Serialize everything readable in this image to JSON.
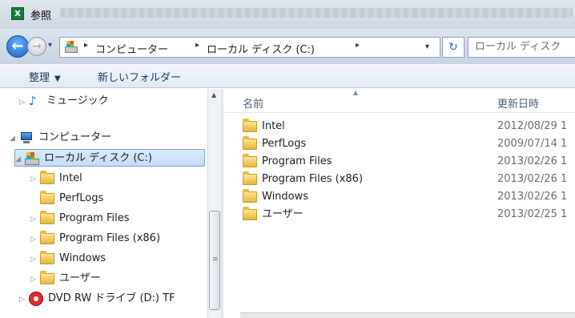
{
  "window": {
    "title": "参照",
    "app_icon_text": "X"
  },
  "navigation": {
    "back_label": "←",
    "forward_label": "→",
    "history_label": "▾",
    "breadcrumbs": [
      "コンピューター",
      "ローカル ディスク (C:)"
    ],
    "separator": "▸",
    "dropdown": "▾",
    "refresh_label": "↻",
    "search_placeholder": "ローカル ディスク"
  },
  "toolbar": {
    "organize_label": "整理",
    "organize_arrow": "▼",
    "new_folder_label": "新しいフォルダー"
  },
  "tree": {
    "music": "ミュージック",
    "computer": "コンピューター",
    "local_disk": "ローカル ディスク (C:)",
    "folders": [
      "Intel",
      "PerfLogs",
      "Program Files",
      "Program Files (x86)",
      "Windows",
      "ユーザー"
    ],
    "dvd": "DVD RW ドライブ (D:) TF"
  },
  "list": {
    "columns": {
      "name": "名前",
      "modified": "更新日時"
    },
    "rows": [
      {
        "name": "Intel",
        "date": "2012/08/29 1"
      },
      {
        "name": "PerfLogs",
        "date": "2009/07/14 1"
      },
      {
        "name": "Program Files",
        "date": "2013/02/26 1"
      },
      {
        "name": "Program Files (x86)",
        "date": "2013/02/26 1"
      },
      {
        "name": "Windows",
        "date": "2013/02/26 1"
      },
      {
        "name": "ユーザー",
        "date": "2013/02/25 1"
      }
    ]
  },
  "colors": {
    "selection": "#c1dcfc",
    "toolbar": "#dfe9f5",
    "folder": "#e5b73b",
    "title_bar": "#cdd8e4"
  }
}
